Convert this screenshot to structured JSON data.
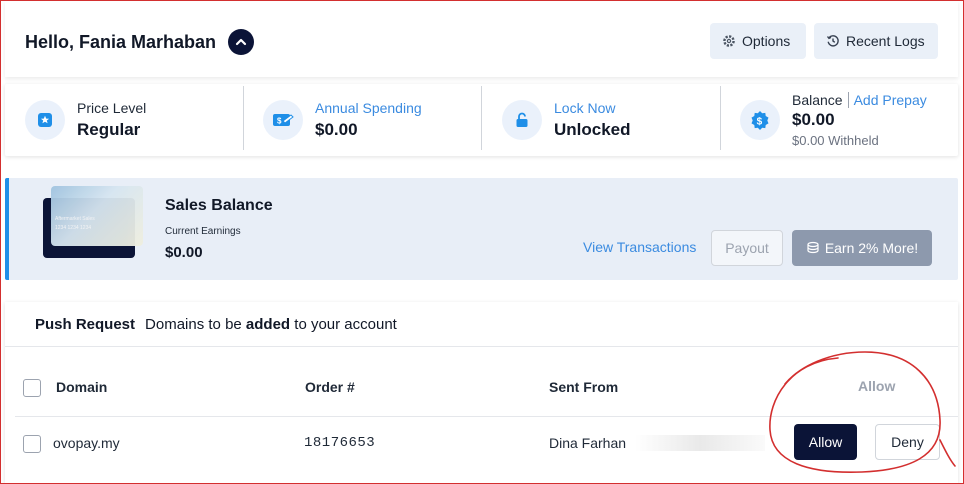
{
  "header": {
    "greeting": "Hello, Fania Marhaban",
    "options_label": "Options",
    "recent_logs_label": "Recent Logs"
  },
  "stats": {
    "price_level": {
      "label": "Price Level",
      "value": "Regular"
    },
    "annual_spending": {
      "label": "Annual Spending",
      "value": "$0.00"
    },
    "lock": {
      "label": "Lock Now",
      "value": "Unlocked"
    },
    "balance": {
      "label": "Balance",
      "link": "Add Prepay",
      "value": "$0.00",
      "withheld": "$0.00 Withheld"
    }
  },
  "sales": {
    "card_text_1": "Aftermarket Sales",
    "card_text_2": "1234 1234 1234",
    "title": "Sales Balance",
    "sub_label": "Current Earnings",
    "amount": "$0.00",
    "view_transactions": "View Transactions",
    "payout": "Payout",
    "earn": "Earn 2% More!"
  },
  "push": {
    "title": "Push Request",
    "desc_before": "Domains to be",
    "desc_bold": "added",
    "desc_after": "to your account",
    "columns": {
      "domain": "Domain",
      "order": "Order #",
      "sent_from": "Sent From",
      "allow": "Allow"
    },
    "rows": [
      {
        "domain": "ovopay.my",
        "order": "18176653",
        "sent_from": "Dina Farhan"
      }
    ],
    "allow_label": "Allow",
    "deny_label": "Deny"
  },
  "colors": {
    "navy": "#0b1437",
    "link_blue": "#3b8be0",
    "accent_bar": "#1f8fe8",
    "annotation_red": "#d32f2f"
  }
}
